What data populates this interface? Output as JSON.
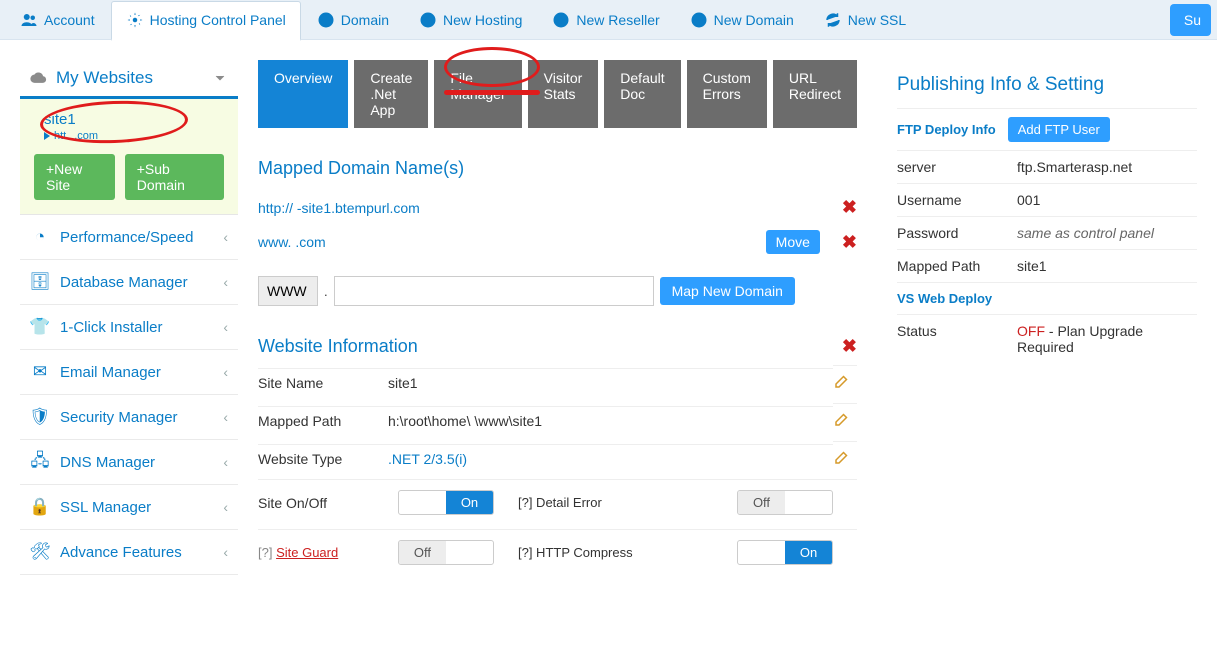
{
  "top_nav": {
    "account": "Account",
    "hosting_cp": "Hosting Control Panel",
    "domain": "Domain",
    "new_hosting": "New Hosting",
    "new_reseller": "New Reseller",
    "new_domain": "New Domain",
    "new_ssl": "New SSL",
    "support": "Su"
  },
  "sidebar": {
    "header": "My Websites",
    "site": {
      "name": "site1",
      "url_prefix": "htt",
      "url_suffix": ".com"
    },
    "new_site": "+New Site",
    "sub_domain": "+Sub Domain",
    "items": [
      {
        "label": "Performance/Speed",
        "icon": "gauge-icon"
      },
      {
        "label": "Database Manager",
        "icon": "database-icon"
      },
      {
        "label": "1-Click Installer",
        "icon": "shirt-icon"
      },
      {
        "label": "Email Manager",
        "icon": "envelope-icon"
      },
      {
        "label": "Security Manager",
        "icon": "shield-icon"
      },
      {
        "label": "DNS Manager",
        "icon": "server-icon"
      },
      {
        "label": "SSL Manager",
        "icon": "lock-icon"
      },
      {
        "label": "Advance Features",
        "icon": "tools-icon"
      }
    ]
  },
  "tabs": [
    "Overview",
    "Create .Net App",
    "File Manager",
    "Visitor Stats",
    "Default Doc",
    "Custom Errors",
    "URL Redirect"
  ],
  "mapped": {
    "title": "Mapped Domain Name(s)",
    "d1": "http://              -site1.btempurl.com",
    "d2": "www.              .com",
    "move": "Move",
    "www": "WWW",
    "dot": ".",
    "map_new": "Map New Domain"
  },
  "website_info": {
    "title": "Website Information",
    "site_name_lbl": "Site Name",
    "site_name": "site1",
    "mapped_path_lbl": "Mapped Path",
    "mapped_path": "h:\\root\\home\\              \\www\\site1",
    "website_type_lbl": "Website Type",
    "website_type": ".NET 2/3.5(i)",
    "site_onoff_lbl": "Site On/Off",
    "detail_err": "[?] Detail Error",
    "off": "Off",
    "on": "On",
    "q": "[?]",
    "site_guard": "Site Guard",
    "http_comp": "[?] HTTP Compress"
  },
  "publishing": {
    "title": "Publishing Info & Setting",
    "ftp_deploy": "FTP Deploy Info",
    "add_ftp": "Add FTP User",
    "server_lbl": "server",
    "server": "ftp.Smarterasp.net",
    "username_lbl": "Username",
    "username": "            001",
    "password_lbl": "Password",
    "password": "same as control panel",
    "mapped_path_lbl": "Mapped Path",
    "mapped_path": "site1",
    "vs_deploy": "VS Web Deploy",
    "status_lbl": "Status",
    "status_off": "OFF",
    "status_rest": " - Plan Upgrade Required"
  }
}
